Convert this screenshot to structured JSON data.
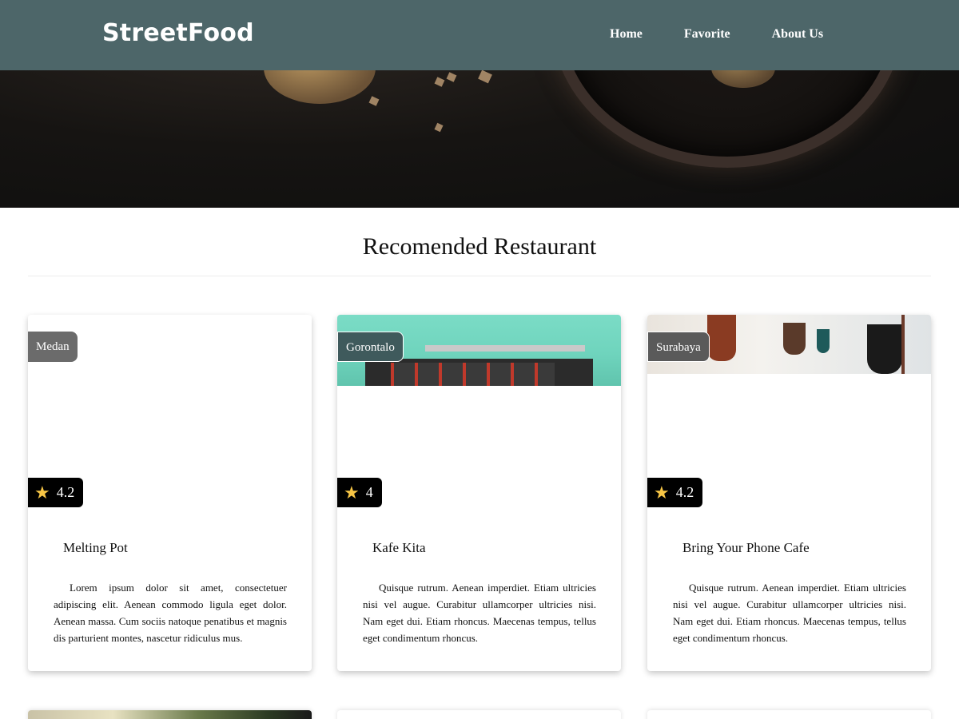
{
  "navbar": {
    "brand": "StreetFood",
    "links": [
      "Home",
      "Favorite",
      "About Us"
    ],
    "background": "#4d6669"
  },
  "main": {
    "title": "Recomended Restaurant",
    "restaurants": [
      {
        "city": "Medan",
        "rating": "4.2",
        "name": "Melting Pot",
        "description": "Lorem ipsum dolor sit amet, consectetuer adipiscing elit. Aenean commodo ligula eget dolor. Aenean massa. Cum sociis natoque penatibus et magnis dis parturient montes, nascetur ridiculus mus."
      },
      {
        "city": "Gorontalo",
        "rating": "4",
        "name": "Kafe Kita",
        "description": "Quisque rutrum. Aenean imperdiet. Etiam ultricies nisi vel augue. Curabitur ullamcorper ultricies nisi. Nam eget dui. Etiam rhoncus. Maecenas tempus, tellus eget condimentum rhoncus."
      },
      {
        "city": "Surabaya",
        "rating": "4.2",
        "name": "Bring Your Phone Cafe",
        "description": "Quisque rutrum. Aenean imperdiet. Etiam ultricies nisi vel augue. Curabitur ullamcorper ultricies nisi. Nam eget dui. Etiam rhoncus. Maecenas tempus, tellus eget condimentum rhoncus."
      }
    ]
  },
  "colors": {
    "accent": "#4d6669",
    "star": "#f7c545",
    "rating_bg": "#000000"
  },
  "icons": {
    "rating": "star-icon"
  }
}
